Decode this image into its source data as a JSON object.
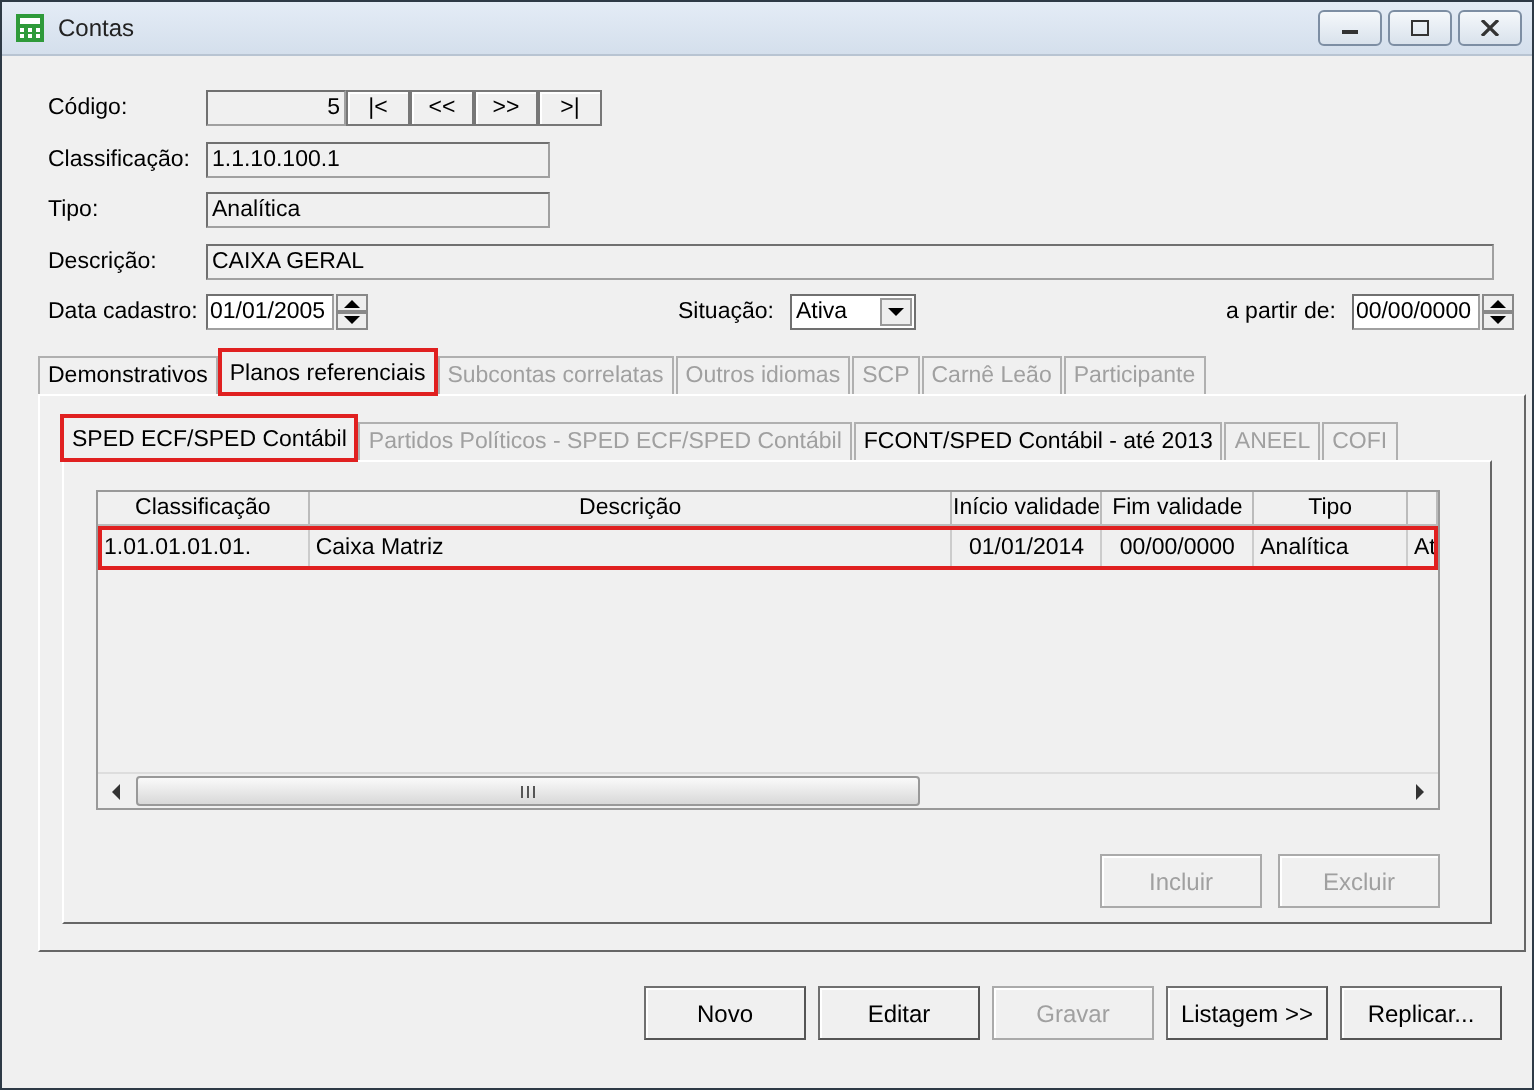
{
  "window": {
    "title": "Contas"
  },
  "form": {
    "codigo": {
      "label": "Código:",
      "value": "5",
      "disabled": true
    },
    "nav_buttons": [
      "|<",
      "<<",
      ">>",
      ">|"
    ],
    "classificacao": {
      "label": "Classificação:",
      "value": "1.1.10.100.1",
      "disabled": true
    },
    "tipo": {
      "label": "Tipo:",
      "value": "Analítica",
      "disabled": true
    },
    "descricao": {
      "label": "Descrição:",
      "value": "CAIXA GERAL",
      "disabled": true
    },
    "data_cadastro": {
      "label": "Data cadastro:",
      "value": "01/01/2005",
      "disabled": false
    },
    "situacao": {
      "label": "Situação:",
      "value": "Ativa",
      "disabled": false
    },
    "a_partir_de": {
      "label": "a partir de:",
      "value": "00/00/0000",
      "disabled": false
    }
  },
  "tabs": [
    {
      "label": "Demonstrativos",
      "selected": false,
      "disabled": false,
      "highlighted": false
    },
    {
      "label": "Planos referenciais",
      "selected": true,
      "disabled": false,
      "highlighted": true
    },
    {
      "label": "Subcontas correlatas",
      "selected": false,
      "disabled": true,
      "highlighted": false
    },
    {
      "label": "Outros idiomas",
      "selected": false,
      "disabled": true,
      "highlighted": false
    },
    {
      "label": "SCP",
      "selected": false,
      "disabled": true,
      "highlighted": false
    },
    {
      "label": "Carnê Leão",
      "selected": false,
      "disabled": true,
      "highlighted": false
    },
    {
      "label": "Participante",
      "selected": false,
      "disabled": true,
      "highlighted": false
    }
  ],
  "subtabs": [
    {
      "label": "SPED ECF/SPED Contábil",
      "selected": true,
      "disabled": false,
      "highlighted": true
    },
    {
      "label": "Partidos Políticos - SPED ECF/SPED Contábil",
      "selected": false,
      "disabled": true,
      "highlighted": false
    },
    {
      "label": "FCONT/SPED Contábil - até 2013",
      "selected": false,
      "disabled": false,
      "highlighted": false
    },
    {
      "label": "ANEEL",
      "selected": false,
      "disabled": true,
      "highlighted": false
    },
    {
      "label": "COFI",
      "selected": false,
      "disabled": true,
      "highlighted": false
    }
  ],
  "table": {
    "columns": [
      "Classificação",
      "Descrição",
      "Início validade",
      "Fim validade",
      "Tipo"
    ],
    "rows": [
      {
        "cells": [
          "1.01.01.01.01.",
          "Caixa Matriz",
          "01/01/2014",
          "00/00/0000",
          "Analítica",
          "At"
        ],
        "highlighted": true
      }
    ]
  },
  "grid_buttons": [
    {
      "label": "Incluir",
      "disabled": true
    },
    {
      "label": "Excluir",
      "disabled": true
    }
  ],
  "buttons": [
    {
      "label": "Novo",
      "disabled": false
    },
    {
      "label": "Editar",
      "disabled": false
    },
    {
      "label": "Gravar",
      "disabled": true
    },
    {
      "label": "Listagem >>",
      "disabled": false
    },
    {
      "label": "Replicar...",
      "disabled": false
    }
  ]
}
